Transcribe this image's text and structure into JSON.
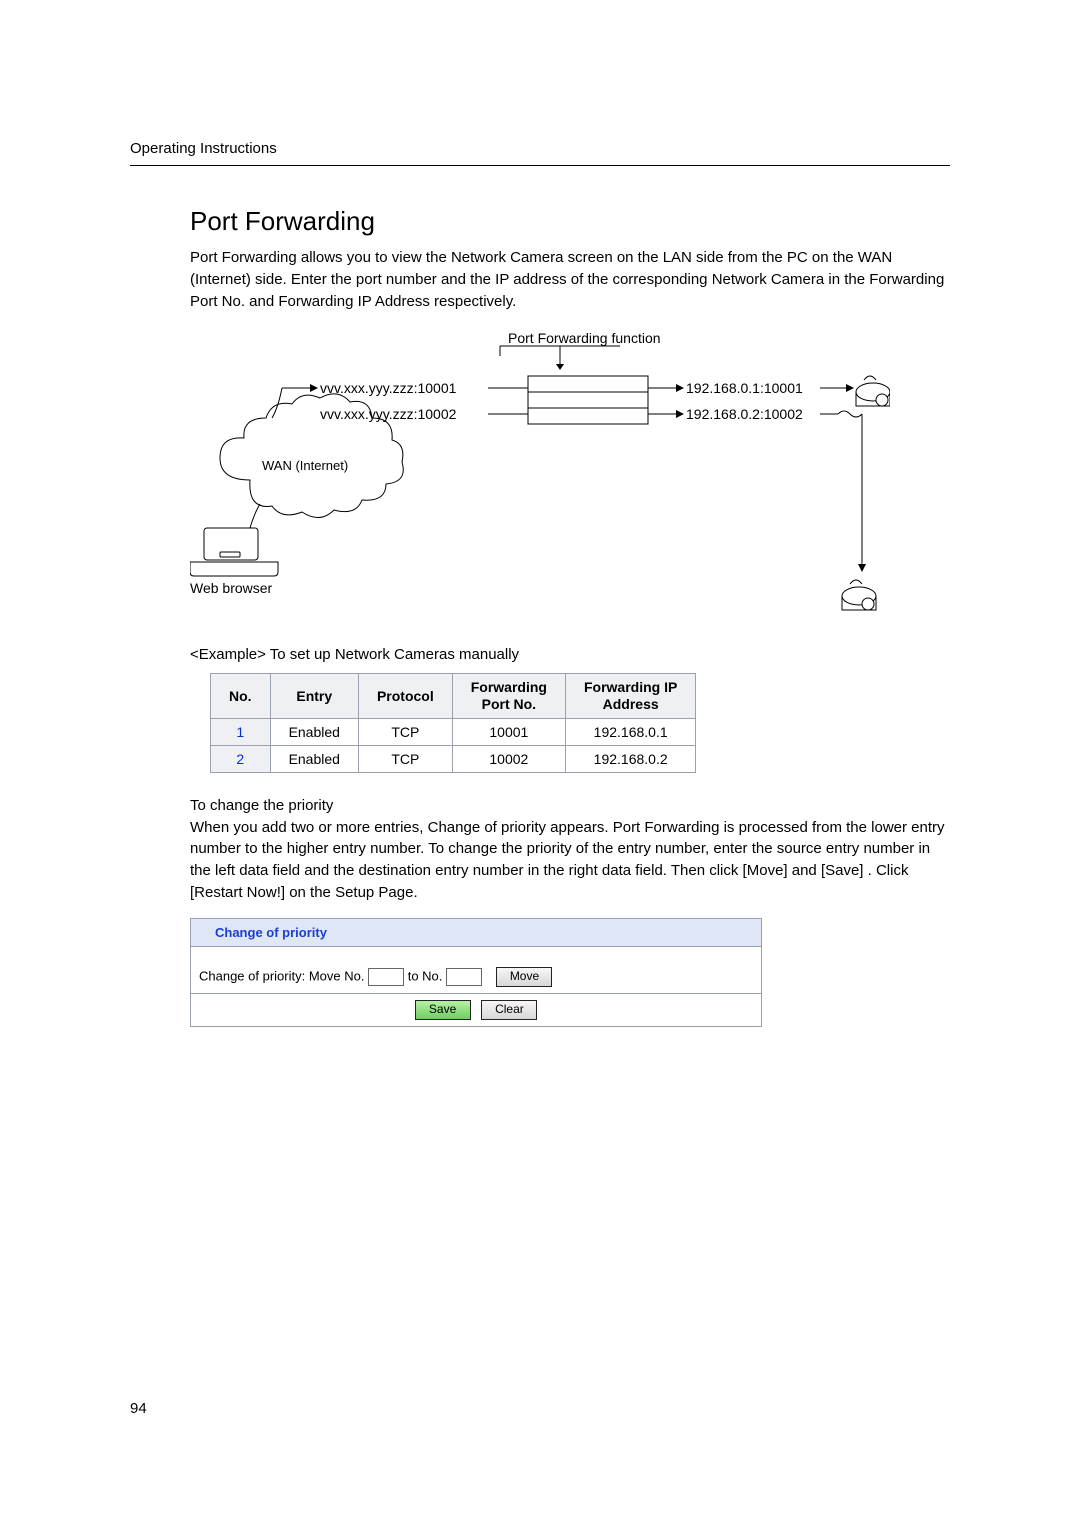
{
  "header": {
    "running_title": "Operating Instructions"
  },
  "section": {
    "title": "Port Forwarding"
  },
  "para1": "Port Forwarding allows you to view the Network Camera screen on the LAN side from the PC on the WAN (Internet) side. Enter the port number and the IP address of the corresponding Network Camera in the Forwarding Port No. and Forwarding IP Address respectively.",
  "diagram": {
    "caption": "Port Forwarding function",
    "wan_addr1": "vvv.xxx.yyy.zzz:10001",
    "wan_addr2": "vvv.xxx.yyy.zzz:10002",
    "lan_addr1": "192.168.0.1:10001",
    "lan_addr2": "192.168.0.2:10002",
    "cloud_label": "WAN (Internet)",
    "browser_label": "Web browser"
  },
  "example_label": "<Example> To set up Network Cameras manually",
  "table": {
    "headers": {
      "no": "No.",
      "entry": "Entry",
      "protocol": "Protocol",
      "port": "Forwarding Port No.",
      "ip": "Forwarding IP Address"
    },
    "rows": [
      {
        "no": "1",
        "entry": "Enabled",
        "protocol": "TCP",
        "port": "10001",
        "ip": "192.168.0.1"
      },
      {
        "no": "2",
        "entry": "Enabled",
        "protocol": "TCP",
        "port": "10002",
        "ip": "192.168.0.2"
      }
    ]
  },
  "priority_heading": "To change the priority",
  "para2": "When you add two or more entries, Change of priority appears. Port Forwarding is processed from the lower entry number to the higher entry number. To change the priority of the entry number, enter the source entry number in the left data field and the destination entry number in the right data field. Then click [Move] and [Save] . Click [Restart Now!] on the Setup Page.",
  "panel": {
    "title": "Change of priority",
    "row_prefix": "Change of priority: Move No.",
    "row_mid": "to No.",
    "move_btn": "Move",
    "save_btn": "Save",
    "clear_btn": "Clear"
  },
  "page_number": "94"
}
